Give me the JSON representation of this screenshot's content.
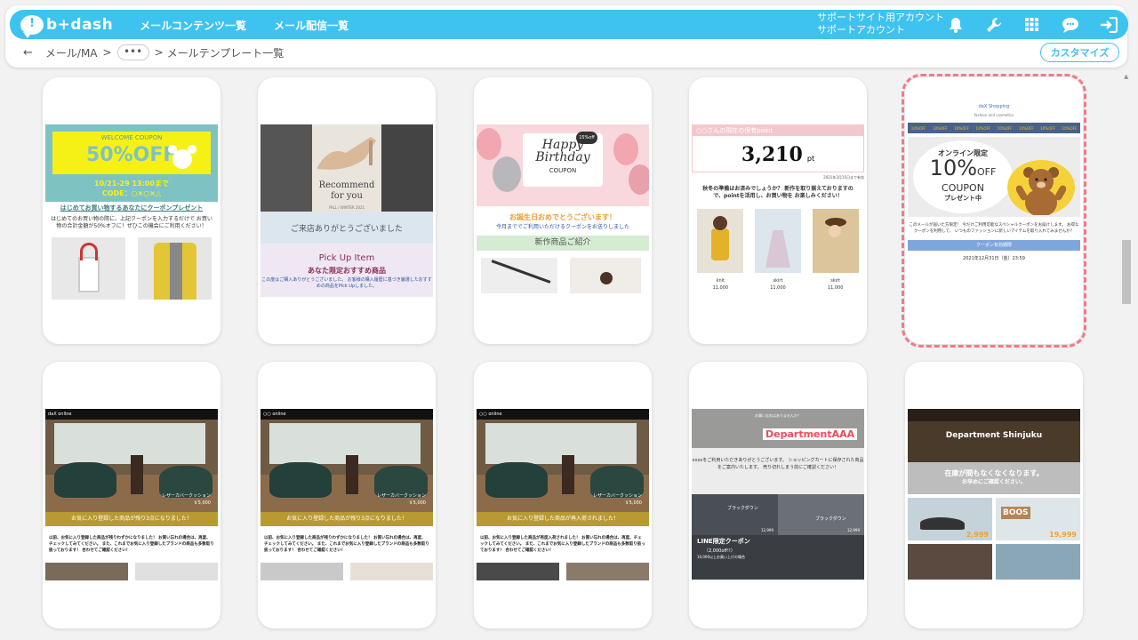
{
  "header": {
    "logo_text": "b+dash",
    "nav": [
      "メールコンテンツ一覧",
      "メール配信一覧"
    ],
    "account_line1": "サポートサイト用アカウント",
    "account_line2": "サポートアカウント",
    "icons": [
      "bell-icon",
      "wrench-icon",
      "grid-icon",
      "chat-icon",
      "logout-icon"
    ]
  },
  "breadcrumb": {
    "back": "←",
    "item1": "メール/MA",
    "sep": ">",
    "dots": "•••",
    "item2": "メールテンプレート一覧"
  },
  "customize_label": "カスタマイズ",
  "templates": [
    {
      "welcome": "WELCOME COUPON",
      "pct": "50%OFF",
      "date": "10/21-29 13:00まで",
      "code": "CODE：○×○×△",
      "headline": "はじめてお買い物するあなたにクーポンプレゼント",
      "body": "はじめてのお買い物の際に、上記クーポンを入力するだけで お買い物の合計金額が50%オフに！ぜひこの機会にご利用ください！"
    },
    {
      "recommend": "Recommend",
      "for_you": "for you",
      "season": "FALL / WINTER 2021",
      "thanks": "ご来店ありがとうございました",
      "pickup": "Pick Up Item",
      "pickup_sub": "あなた限定おすすめ商品",
      "pickup_body": "この度はご購入ありがとうございました。 お客様の購入履歴に基づき厳選したおすすめの商品をPick Upしました。"
    },
    {
      "happy": "Happy Birthday",
      "coupon": "COUPON",
      "off": "15%off",
      "line1": "お誕生日おめでとうございます！",
      "line2": "今月まででご利用いただけるクーポンをお送りしました",
      "newitems": "新作商品ご紹介"
    },
    {
      "points_title": "○○さんの現在の保有point",
      "points": "3,210",
      "unit": "pt",
      "expiry": "2021年3月15日まで有効",
      "msg": "秋冬の準備はお済みでしょうか？ 新作を取り揃えておりますので、pointを活用し、お買い物を お楽しみください！",
      "items": [
        {
          "name": "knit",
          "price": "11,000"
        },
        {
          "name": "skirt",
          "price": "11,000"
        },
        {
          "name": "skirt",
          "price": "11,000"
        }
      ]
    },
    {
      "shop": "daX Shopping",
      "shop_sub": "fashion and cosmetics",
      "off_strip": "10%OFF",
      "limit": "オンライン限定",
      "pct": "10%",
      "off": "OFF",
      "coupon": "COUPON",
      "present": "プレゼント中",
      "msg": "このメールが届いた方限定！ 今だけご利用可能なスペシャルクーポンをお届けします。 お得なクーポンを利用して、 いつものファッションに新しいアイテムを取り入れてみませんか？",
      "btn": "クーポン有効期限",
      "date": "2021年12月31日（金）23:59"
    },
    {
      "brand": "daX online",
      "label": "レザーカバークッション",
      "price": "￥5,000",
      "banner": "お気に入り登録した商品が残り3点になりました！",
      "body": "以前、お気に入り登録した商品が残りわずかになりました！ お買い忘れの場合は、再度、チェックしてみてください。 また、これまでお気に入り登録したブランドの商品も多数取り扱っております！ 合わせてご確認ください！"
    },
    {
      "brand": "○○ online",
      "label": "レザーカバークッション",
      "price": "￥5,000",
      "banner": "お気に入り登録した商品が残り3点になりました！",
      "body": "以前、お気に入り登録した商品が残りわずかになりました！ お買い忘れの場合は、再度、チェックしてみてください。 また、これまでお気に入り登録したブランドの商品も多数取り扱っております！ 合わせてご確認ください！"
    },
    {
      "brand": "○○ online",
      "label": "レザーカバークッション",
      "price": "￥5,000",
      "banner": "お気に入り登録した商品が再入荷されました！",
      "body": "以前、お気に入り登録した商品が再度入荷されました！ お買い忘れの場合は、再度、チェックしてみてください。 また、これまでお気に入り登録したブランドの商品も多数取り扱っております！ 合わせてご確認ください！"
    },
    {
      "top": "お買い忘れはありませんか？",
      "dept": "DepartmentAAA",
      "msg": "xxxxをご利用いただきありがとうございます。 ショッピングカートに保存された商品をご案内いたします。 売り切れしまう前にご確認ください！",
      "p1": "ブラックダウン",
      "p1price": "12,999",
      "p2": "ブラックダウン",
      "p2price": "12,999",
      "line": "LINE限定クーポン",
      "line_sub": "（2,000off!!）",
      "line_note": "10,000以上お買い上げの場合"
    },
    {
      "dept": "Department Shinjuku",
      "msg": "在庫が間もなくなくなります。",
      "msg2": "お早めにご確認ください。",
      "b1": "2,999",
      "b2": "BOOS",
      "b3": "19,999"
    }
  ]
}
